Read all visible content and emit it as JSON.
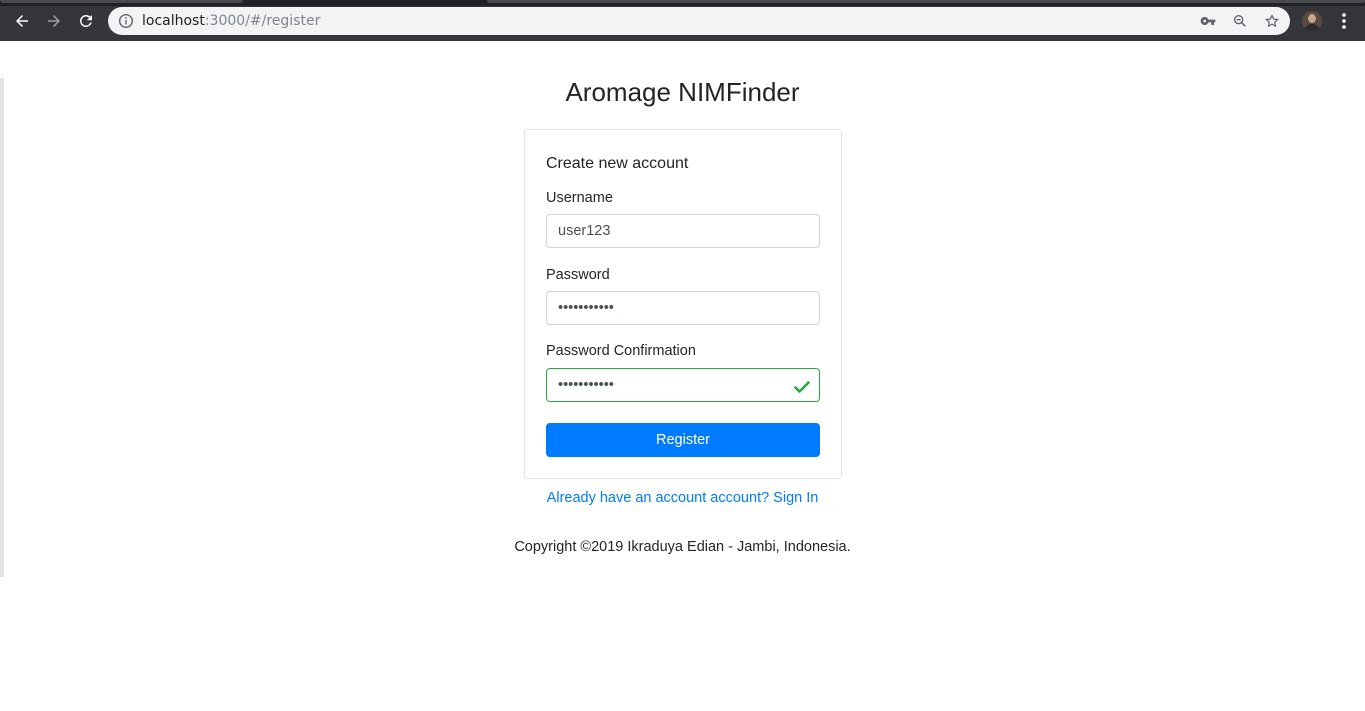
{
  "browser": {
    "url_host": "localhost",
    "url_rest": ":3000/#/register",
    "icons": {
      "back": "arrow-left-icon",
      "forward": "arrow-right-icon",
      "reload": "reload-icon",
      "site_info": "info-icon",
      "password_key": "key-icon",
      "zoom": "zoom-out-icon",
      "bookmark": "star-icon",
      "menu": "kebab-menu-icon"
    }
  },
  "page": {
    "app_title": "Aromage NIMFinder",
    "card_title": "Create new account",
    "username_label": "Username",
    "username_value": "user123",
    "password_label": "Password",
    "password_value": "•••••••••••",
    "password_confirm_label": "Password Confirmation",
    "password_confirm_value": "•••••••••••",
    "register_label": "Register",
    "signin_link": "Already have an account account? Sign In",
    "copyright": "Copyright ©2019 Ikraduya Edian - Jambi, Indonesia."
  },
  "colors": {
    "primary": "#007bff",
    "valid": "#28a745",
    "chrome_bg": "#35363a"
  }
}
